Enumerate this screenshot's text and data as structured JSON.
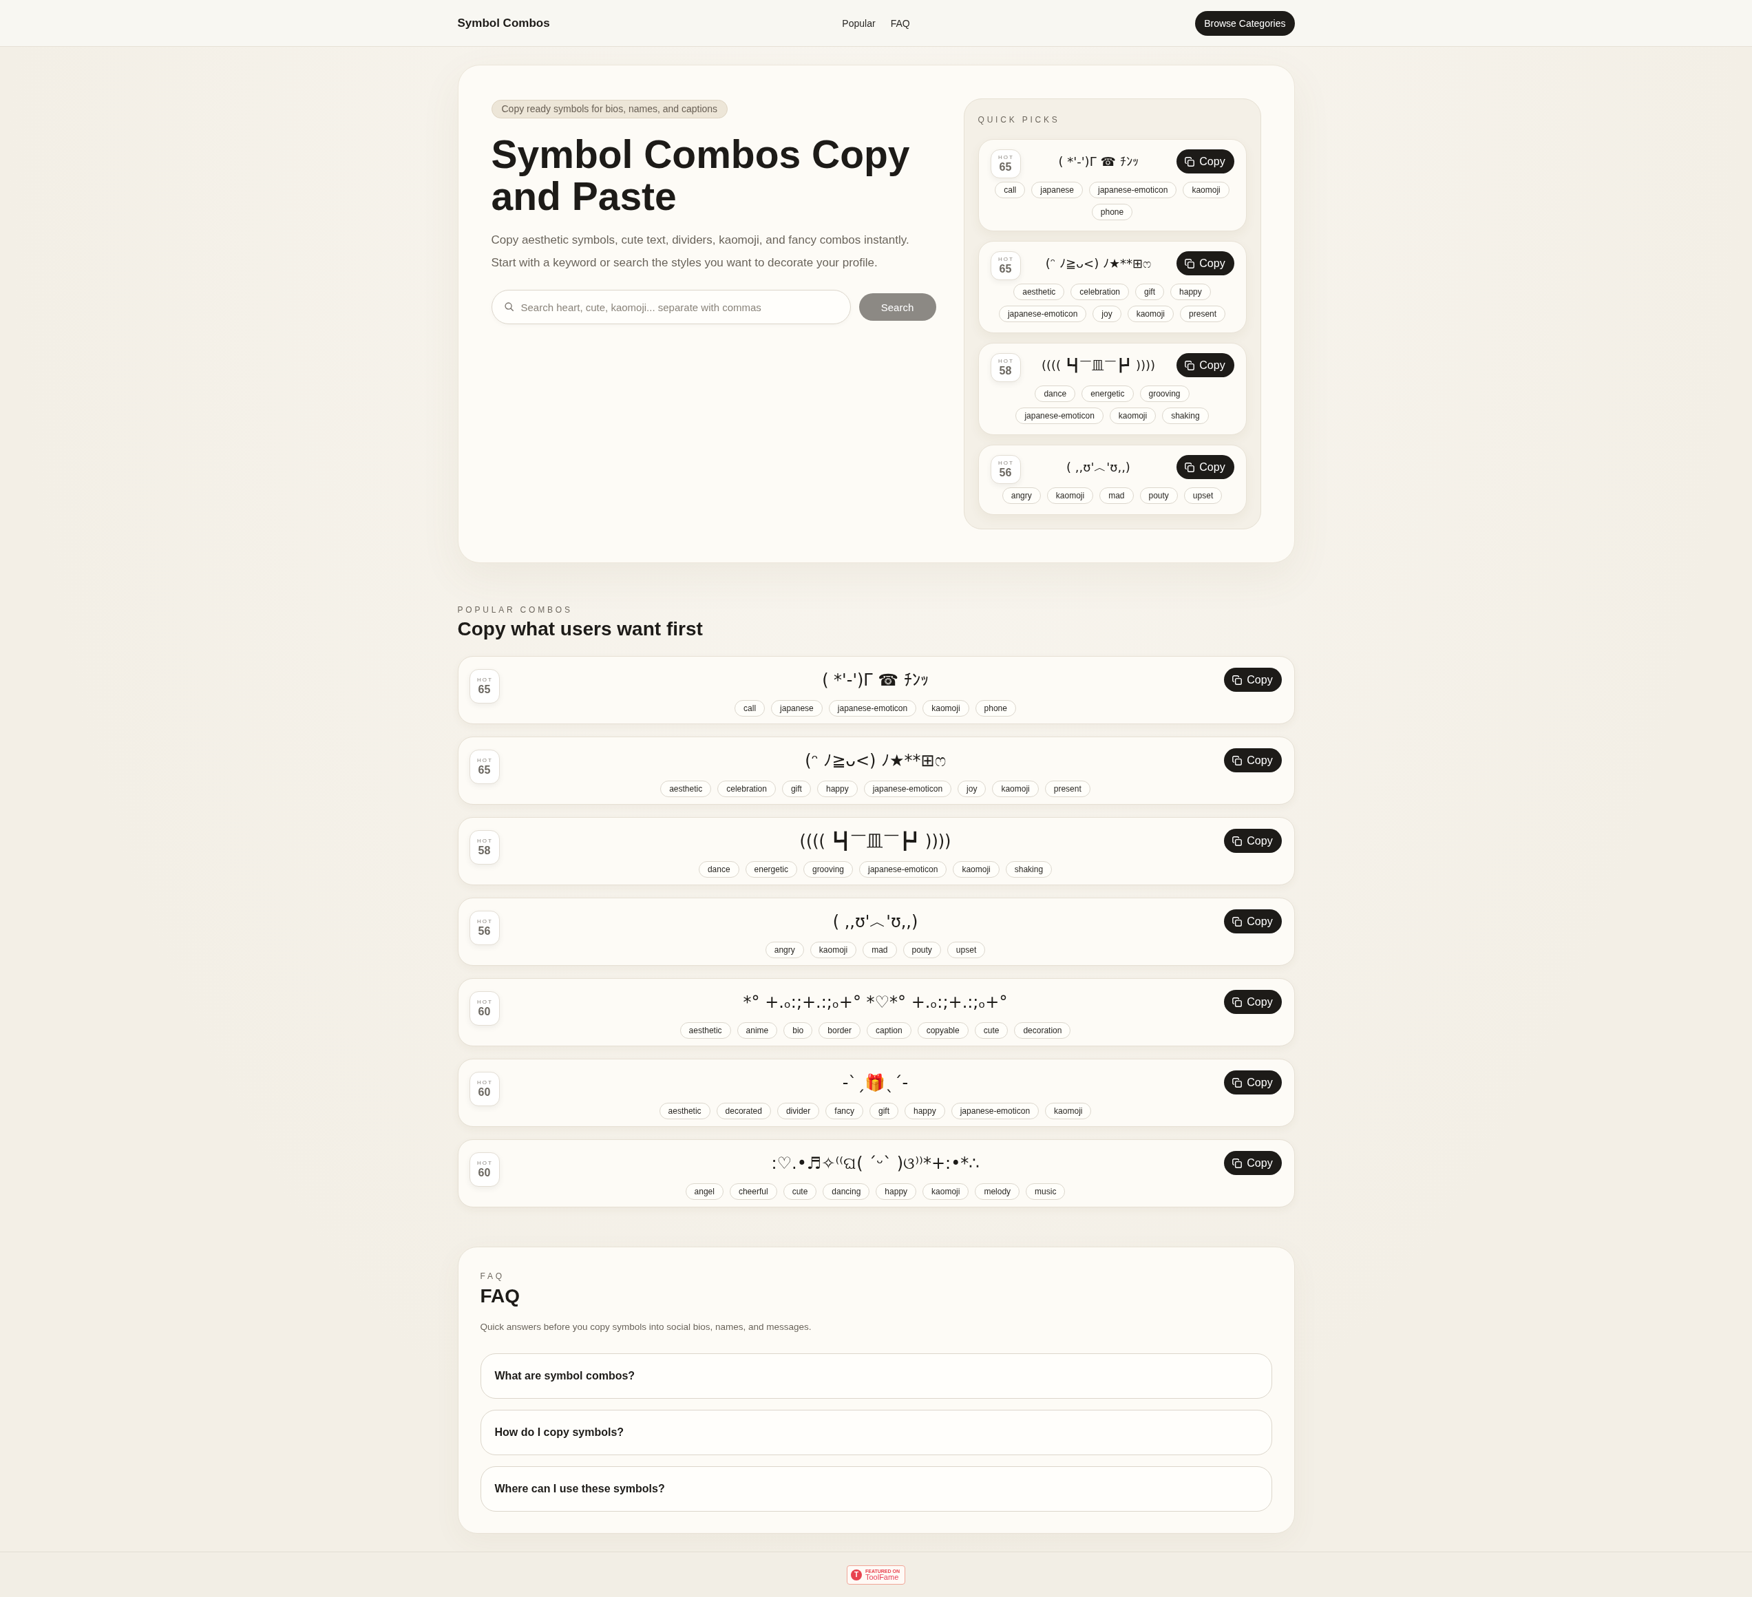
{
  "header": {
    "logo": "Symbol Combos",
    "nav": [
      {
        "label": "Popular"
      },
      {
        "label": "FAQ"
      }
    ],
    "button": "Browse Categories"
  },
  "hero": {
    "badge": "Copy ready symbols for bios, names, and captions",
    "title": "Symbol Combos Copy and Paste",
    "description": "Copy aesthetic symbols, cute text, dividers, kaomoji, and fancy combos instantly. Start with a keyword or search the styles you want to decorate your profile.",
    "search": {
      "placeholder": "Search heart, cute, kaomoji... separate with commas",
      "button": {
        "label": "Search",
        "disabled": true
      }
    },
    "quick_picks": {
      "title": "QUICK PICKS",
      "items": [
        {
          "hot_label": "HOT",
          "hot": "65",
          "combo": "( *'-')Γ ☎ ﾁﾝｯ",
          "button": "Copy",
          "tags": [
            "call",
            "japanese",
            "japanese-emoticon",
            "kaomoji",
            "phone"
          ]
        },
        {
          "hot_label": "HOT",
          "hot": "65",
          "combo": "(ᵔ ﾉ≧ᴗ<) ﾉ★**⊞ෆ",
          "button": "Copy",
          "tags": [
            "aesthetic",
            "celebration",
            "gift",
            "happy",
            "japanese-emoticon",
            "joy",
            "kaomoji",
            "present"
          ]
        },
        {
          "hot_label": "HOT",
          "hot": "58",
          "combo": "(((( ┗┫￣皿￣┣┛ ))))",
          "button": "Copy",
          "tags": [
            "dance",
            "energetic",
            "grooving",
            "japanese-emoticon",
            "kaomoji",
            "shaking"
          ]
        },
        {
          "hot_label": "HOT",
          "hot": "56",
          "combo": "( ,,ʊ'︿'ʊ,,)",
          "button": "Copy",
          "tags": [
            "angry",
            "kaomoji",
            "mad",
            "pouty",
            "upset"
          ]
        }
      ]
    }
  },
  "popular": {
    "eyebrow": "POPULAR COMBOS",
    "title": "Copy what users want first",
    "items": [
      {
        "hot_label": "HOT",
        "hot": "65",
        "combo": "( *'-')Γ ☎ ﾁﾝｯ",
        "button": "Copy",
        "tags": [
          "call",
          "japanese",
          "japanese-emoticon",
          "kaomoji",
          "phone"
        ]
      },
      {
        "hot_label": "HOT",
        "hot": "65",
        "combo": "(ᵔ ﾉ≧ᴗ<) ﾉ★**⊞ෆ",
        "button": "Copy",
        "tags": [
          "aesthetic",
          "celebration",
          "gift",
          "happy",
          "japanese-emoticon",
          "joy",
          "kaomoji",
          "present"
        ]
      },
      {
        "hot_label": "HOT",
        "hot": "58",
        "combo": "(((( ┗┫￣皿￣┣┛ ))))",
        "button": "Copy",
        "tags": [
          "dance",
          "energetic",
          "grooving",
          "japanese-emoticon",
          "kaomoji",
          "shaking"
        ]
      },
      {
        "hot_label": "HOT",
        "hot": "56",
        "combo": "( ,,ʊ'︿'ʊ,,)",
        "button": "Copy",
        "tags": [
          "angry",
          "kaomoji",
          "mad",
          "pouty",
          "upset"
        ]
      },
      {
        "hot_label": "HOT",
        "hot": "60",
        "combo": "*° +.ₒ:;+.:;ₒ+° *♡*° +.ₒ:;+.:;ₒ+°",
        "button": "Copy",
        "tags": [
          "aesthetic",
          "anime",
          "bio",
          "border",
          "caption",
          "copyable",
          "cute",
          "decoration"
        ]
      },
      {
        "hot_label": "HOT",
        "hot": "60",
        "combo": "-ˋˏ🎁ˎˊ-",
        "button": "Copy",
        "tags": [
          "aesthetic",
          "decorated",
          "divider",
          "fancy",
          "gift",
          "happy",
          "japanese-emoticon",
          "kaomoji"
        ]
      },
      {
        "hot_label": "HOT",
        "hot": "60",
        "combo": ":♡.•♬✧⁽⁽ଘ( ˊᵕˋ )ଓ⁾⁾*+:•*∴",
        "button": "Copy",
        "tags": [
          "angel",
          "cheerful",
          "cute",
          "dancing",
          "happy",
          "kaomoji",
          "melody",
          "music"
        ]
      }
    ]
  },
  "faq": {
    "eyebrow": "FAQ",
    "title": "FAQ",
    "description": "Quick answers before you copy symbols into social bios, names, and messages.",
    "questions": [
      "What are symbol combos?",
      "How do I copy symbols?",
      "Where can I use these symbols?"
    ]
  },
  "footer": {
    "badge": {
      "logo_letter": "T",
      "caption": "FEATURED ON",
      "name": "ToolFame"
    }
  }
}
